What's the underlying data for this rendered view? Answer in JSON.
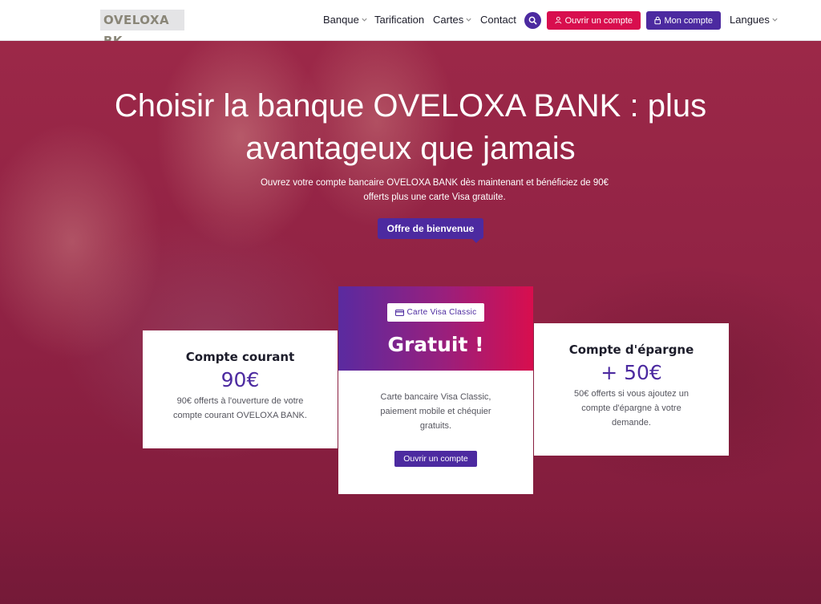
{
  "nav": {
    "logo": "OVELOXA BK",
    "items": [
      {
        "label": "Banque",
        "has_dropdown": true
      },
      {
        "label": "Tarification",
        "has_dropdown": false
      },
      {
        "label": "Cartes",
        "has_dropdown": true
      },
      {
        "label": "Contact",
        "has_dropdown": false
      }
    ],
    "search_icon": "search-icon",
    "open_account_label": "Ouvrir un compte",
    "my_account_label": "Mon compte",
    "languages_label": "Langues"
  },
  "hero": {
    "title_line1": "Choisir la banque OVELOXA BANK : plus",
    "title_line2": "avantageux que jamais",
    "subtitle_line1": "Ouvrez votre compte bancaire OVELOXA BANK dès maintenant et bénéficiez de 90€",
    "subtitle_line2": "offerts plus une carte Visa gratuite.",
    "cta_label": "Offre de bienvenue"
  },
  "cards": {
    "left": {
      "title": "Compte courant",
      "price": "90€",
      "desc_line1": "90€ offerts à l'ouverture de votre",
      "desc_line2": "compte courant OVELOXA BANK."
    },
    "middle": {
      "badge": "Carte Visa Classic",
      "price": "Gratuit !",
      "desc_line1": "Carte bancaire Visa Classic,",
      "desc_line2": "paiement mobile et chéquier",
      "desc_line3": "gratuits.",
      "button_label": "Ouvrir un compte"
    },
    "right": {
      "title": "Compte d'épargne",
      "price": "+ 50€",
      "desc_line1": "50€ offerts si vous ajoutez un",
      "desc_line2": "compte d'épargne à votre",
      "desc_line3": "demande."
    }
  },
  "colors": {
    "primary": "#4c2aa0",
    "accent": "#d80e4e",
    "hero_overlay": "#8e2143"
  }
}
